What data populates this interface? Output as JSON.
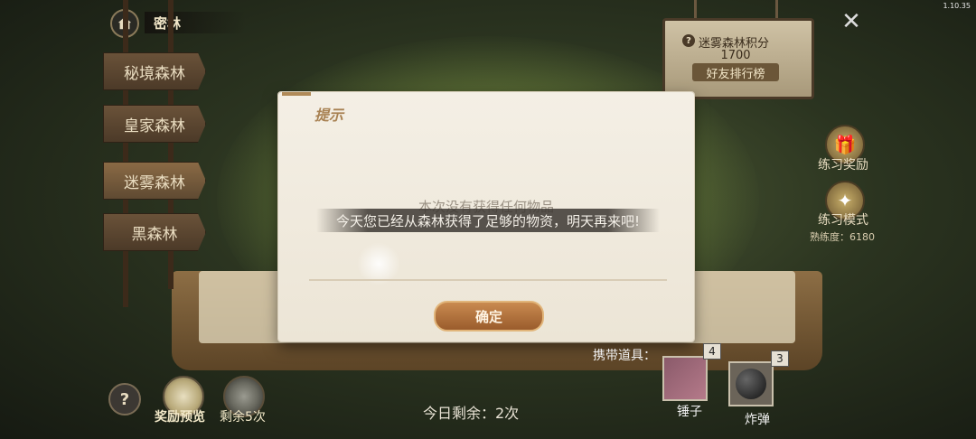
{
  "version": "1.10.35",
  "header": {
    "title": "密林"
  },
  "zones": [
    {
      "label": "秘境森林",
      "active": false
    },
    {
      "label": "皇家森林",
      "active": false
    },
    {
      "label": "迷雾森林",
      "active": true
    },
    {
      "label": "黑森林",
      "active": false
    }
  ],
  "score": {
    "title": "迷雾森林积分",
    "value": "1700",
    "rank_button": "好友排行榜",
    "help_glyph": "?"
  },
  "side": {
    "practice_reward": "练习奖励",
    "practice_mode": "练习模式",
    "mastery": "熟练度：6180"
  },
  "dialog": {
    "title": "提示",
    "message": "本次没有获得任何物品",
    "toast": "今天您已经从森林获得了足够的物资，明天再来吧!",
    "confirm": "确定"
  },
  "bottom": {
    "help": "?",
    "reward_preview": "奖励预览",
    "remaining_label": "剩余5次",
    "today_remaining": "今日剩余：2次",
    "carry_label": "携带道具："
  },
  "items": [
    {
      "name": "锤子",
      "count": "4",
      "icon": "hammer-icon"
    },
    {
      "name": "炸弹",
      "count": "3",
      "icon": "bomb-icon"
    }
  ],
  "colors": {
    "dialog_bg": "#f4efe5",
    "confirm_button": "#b5733e",
    "sign_wood": "#5f4a32"
  }
}
